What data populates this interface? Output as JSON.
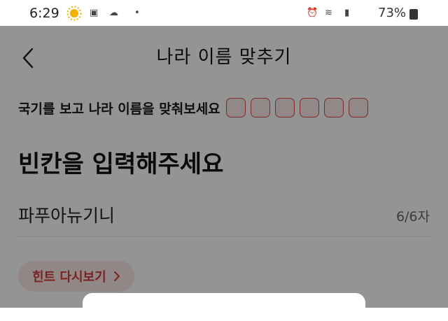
{
  "status_bar": {
    "time": "6:29",
    "battery": "73%",
    "icons": [
      "sun-icon",
      "gallery-icon",
      "cloud-icon",
      "dot-icon",
      "alarm-icon",
      "wifi-icon",
      "signal-icon",
      "battery-icon"
    ]
  },
  "header": {
    "title": "나라 이름 맞추기",
    "back_icon": "chevron-left-icon"
  },
  "instruction": {
    "text": "국기를 보고  나라 이름을 맞춰보세요",
    "slot_count": 6
  },
  "prompt": "빈칸을 입력해주세요",
  "answer": {
    "value": "파푸아뉴기니",
    "counter": "6/6자"
  },
  "hint_button": {
    "label": "힌트 다시보기",
    "icon": "chevron-right-icon"
  },
  "colors": {
    "accent": "#d23c3c",
    "accent_bg": "#fbe8e8",
    "overlay": "#000000"
  }
}
